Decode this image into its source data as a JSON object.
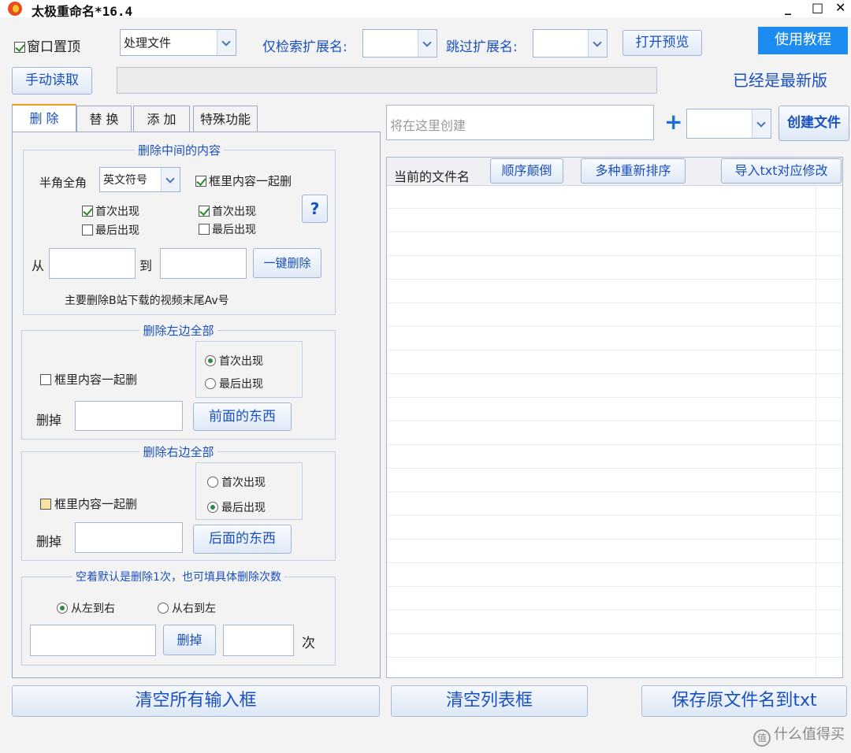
{
  "window": {
    "title": "太极重命名*16.4",
    "minimize": "_",
    "maximize": "□",
    "close": "✕"
  },
  "toolbar": {
    "topmost_label": "窗口置顶",
    "mode_select": "处理文件",
    "search_ext_label": "仅检索扩展名:",
    "search_ext_value": "",
    "skip_ext_label": "跳过扩展名:",
    "skip_ext_value": "",
    "preview_button": "打开预览",
    "tutorial_button": "使用教程",
    "manual_read_button": "手动读取",
    "path_value": "",
    "version_status": "已经是最新版"
  },
  "tabs": [
    {
      "label": "删 除",
      "active": true
    },
    {
      "label": "替 换"
    },
    {
      "label": "添 加"
    },
    {
      "label": "特殊功能"
    }
  ],
  "delete_middle": {
    "title": "删除中间的内容",
    "width_label": "半角全角",
    "width_select": "英文符号",
    "bracket_label": "框里内容一起删",
    "first_label_left": "首次出现",
    "last_label_left": "最后出现",
    "first_label_right": "首次出现",
    "last_label_right": "最后出现",
    "help_button": "?",
    "from_label": "从",
    "to_label": "到",
    "from_value": "",
    "to_value": "",
    "delete_button": "一键删除",
    "hint": "主要删除B站下载的视频末尾Av号"
  },
  "delete_left": {
    "title": "删除左边全部",
    "bracket_label": "框里内容一起删",
    "first_label": "首次出现",
    "last_label": "最后出现",
    "remove_label": "删掉",
    "value": "",
    "button": "前面的东西"
  },
  "delete_right": {
    "title": "删除右边全部",
    "bracket_label": "框里内容一起删",
    "first_label": "首次出现",
    "last_label": "最后出现",
    "remove_label": "删掉",
    "value": "",
    "button": "后面的东西"
  },
  "delete_count": {
    "title": "空着默认是删除1次，也可填具体删除次数",
    "ltr_label": "从左到右",
    "rtl_label": "从右到左",
    "text_value": "",
    "button": "删掉",
    "count_value": "",
    "unit": "次"
  },
  "create": {
    "placeholder": "将在这里创建",
    "plus": "+",
    "ext_value": "",
    "button": "创建文件"
  },
  "list": {
    "col_current": "当前的文件名",
    "reverse_button": "顺序颠倒",
    "resort_button": "多种重新排序",
    "import_button": "导入txt对应修改"
  },
  "bottom": {
    "clear_inputs": "清空所有输入框",
    "clear_list": "清空列表框",
    "save_names": "保存原文件名到txt"
  },
  "watermark": {
    "text": "什么值得买",
    "icon": "值"
  }
}
